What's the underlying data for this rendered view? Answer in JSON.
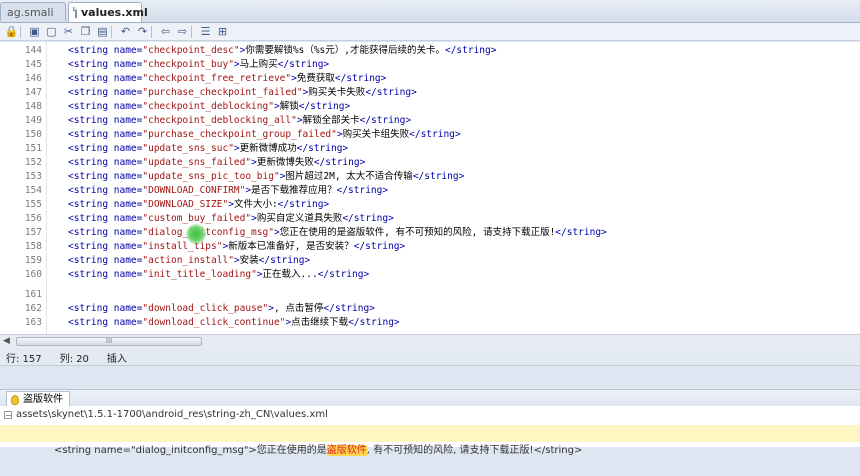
{
  "tabs": [
    {
      "label": "ag.smali",
      "active": false
    },
    {
      "label": "values.xml",
      "active": true
    }
  ],
  "toolbar_icons": [
    "lock-icon",
    "save-icon",
    "file-icon",
    "cut-icon",
    "copy-icon",
    "paste-icon",
    "undo-icon",
    "redo-icon",
    "prev-icon",
    "next-icon",
    "format-icon",
    "insert-icon"
  ],
  "editor": {
    "lines": [
      {
        "num": "144",
        "name": "checkpoint_desc",
        "text": "你需要解锁%s（%s元）,才能获得后续的关卡。"
      },
      {
        "num": "145",
        "name": "checkpoint_buy",
        "text": "马上购买"
      },
      {
        "num": "146",
        "name": "checkpoint_free_retrieve",
        "text": "免费获取"
      },
      {
        "num": "147",
        "name": "purchase_checkpoint_failed",
        "text": "购买关卡失败"
      },
      {
        "num": "148",
        "name": "checkpoint_deblocking",
        "text": "解锁"
      },
      {
        "num": "149",
        "name": "checkpoint_deblocking_all",
        "text": "解锁全部关卡"
      },
      {
        "num": "150",
        "name": "purchase_checkpoint_group_failed",
        "text": "购买关卡组失败"
      },
      {
        "num": "151",
        "name": "update_sns_suc",
        "text": "更新微博成功"
      },
      {
        "num": "152",
        "name": "update_sns_failed",
        "text": "更新微博失败"
      },
      {
        "num": "153",
        "name": "update_sns_pic_too_big",
        "text": "图片超过2M, 太大不适合传输"
      },
      {
        "num": "154",
        "name": "DOWNLOAD_CONFIRM",
        "text": "是否下载推荐应用？"
      },
      {
        "num": "155",
        "name": "DOWNLOAD_SIZE",
        "text": "文件大小:"
      },
      {
        "num": "156",
        "name": "custom_buy_failed",
        "text": "购买自定义道具失败"
      },
      {
        "num": "157",
        "name": "dialog_initconfig_msg",
        "text": "您正在使用的是盗版软件, 有不可预知的风险, 请支持下载正版!"
      },
      {
        "num": "158",
        "name": "install_tips",
        "text": "新版本已准备好, 是否安装？"
      },
      {
        "num": "159",
        "name": "action_install",
        "text": "安装"
      },
      {
        "num": "160",
        "name": "init_title_loading",
        "text": "正在载入..."
      },
      {
        "num": "161",
        "name": "",
        "text": ""
      },
      {
        "num": "162",
        "name": "download_click_pause",
        "text": ", 点击暂停"
      },
      {
        "num": "163",
        "name": "download_click_continue",
        "text": "点击继续下载"
      }
    ]
  },
  "scrollbar": {
    "thumb_label": "III"
  },
  "status": {
    "row_label": "行: 157",
    "col_label": "列: 20",
    "mode_label": "插入"
  },
  "search_panel": {
    "tab_label": "盗版软件",
    "file_path": "assets\\skynet\\1.5.1-1700\\android_res\\string-zh_CN\\values.xml",
    "result_prefix": "<string name=\"dialog_initconfig_msg\">您正在使用的是",
    "result_hit": "盗版软件",
    "result_suffix": ", 有不可预知的风险, 请支持下载正版!</string>"
  }
}
